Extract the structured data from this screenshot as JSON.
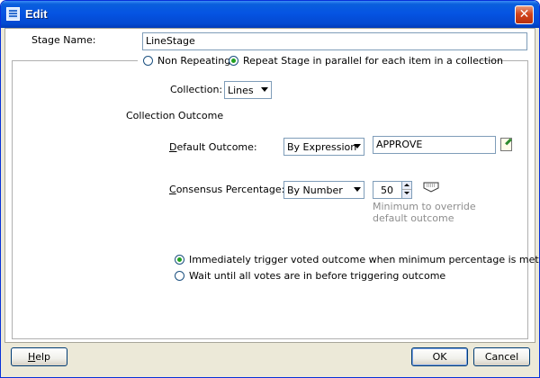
{
  "window": {
    "title": "Edit",
    "close_glyph": "✕"
  },
  "stage_name": {
    "label": "Stage Name:",
    "value": "LineStage"
  },
  "repeat": {
    "non_repeating_label": "Non Repeating",
    "parallel_label": "Repeat Stage in parallel for each item in a collection",
    "selected": "parallel"
  },
  "collection": {
    "label": "Collection:",
    "value": "Lines"
  },
  "collection_outcome": {
    "heading": "Collection Outcome"
  },
  "default_outcome": {
    "label_mnemonic": "D",
    "label_rest": "efault Outcome:",
    "mode": "By Expression",
    "value": "APPROVE"
  },
  "consensus": {
    "label_mnemonic": "C",
    "label_rest": "onsensus Percentage:",
    "mode": "By Number",
    "value": "50",
    "hint_line1": "Minimum to override",
    "hint_line2": "default outcome"
  },
  "trigger": {
    "immediate_label": "Immediately trigger voted outcome when minimum percentage is met",
    "wait_label": "Wait until all votes are in before triggering outcome",
    "selected": "immediate"
  },
  "buttons": {
    "help_mnemonic": "H",
    "help_rest": "elp",
    "ok": "OK",
    "cancel": "Cancel"
  },
  "icons": {
    "app": "dialog-app-icon",
    "edit": "edit-expression-icon",
    "pin": "percentage-pin-icon"
  }
}
